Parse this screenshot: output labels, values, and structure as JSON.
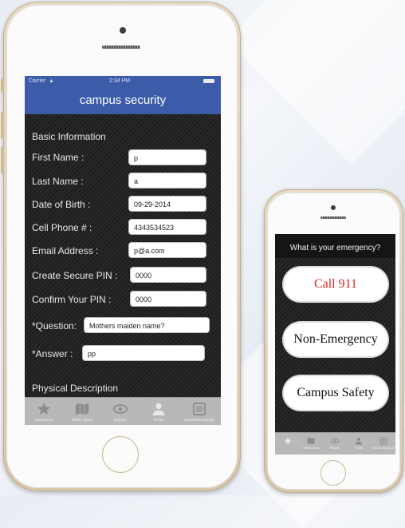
{
  "left_phone": {
    "status": {
      "carrier": "Carrier",
      "time": "2:34 PM"
    },
    "nav_title": "campus security",
    "section_basic": "Basic Information",
    "fields": [
      {
        "label": "First Name :",
        "value": "p"
      },
      {
        "label": "Last Name :",
        "value": "a"
      },
      {
        "label": "Date of Birth :",
        "value": "09-29-2014"
      },
      {
        "label": "Cell Phone # :",
        "value": "4343534523"
      },
      {
        "label": "Email Address :",
        "value": "p@a.com"
      },
      {
        "label": "Create Secure PIN :",
        "value": "0000"
      },
      {
        "label": "Confirm Your PIN :",
        "value": "0000"
      },
      {
        "label": "*Question:",
        "value": "Mothers maiden name?"
      },
      {
        "label": "*Answer :",
        "value": "pp"
      }
    ],
    "section_physical": "Physical Description",
    "tabs": [
      {
        "label": "Emergency",
        "icon": "star-icon"
      },
      {
        "label": "Safety Check",
        "icon": "map-icon"
      },
      {
        "label": "Reports",
        "icon": "eye-icon"
      },
      {
        "label": "Profile",
        "icon": "person-icon"
      },
      {
        "label": "Student Handbook",
        "icon": "book-icon"
      }
    ]
  },
  "right_phone": {
    "header": "What is your emergency?",
    "buttons": [
      {
        "label": "Call 911",
        "color": "#e0231c"
      },
      {
        "label": "Non-Emergency",
        "color": "#111111"
      },
      {
        "label": "Campus Safety",
        "color": "#111111"
      }
    ],
    "tabs": [
      {
        "label": "",
        "icon": "star-icon"
      },
      {
        "label": "Safety Check",
        "icon": "map-icon"
      },
      {
        "label": "Reports",
        "icon": "eye-icon"
      },
      {
        "label": "Profile",
        "icon": "person-icon"
      },
      {
        "label": "Student Handbook",
        "icon": "book-icon"
      }
    ]
  },
  "colors": {
    "nav_blue": "#3c5ba9",
    "tab_bar": "#b8b8b8",
    "call_red": "#e0231c"
  }
}
